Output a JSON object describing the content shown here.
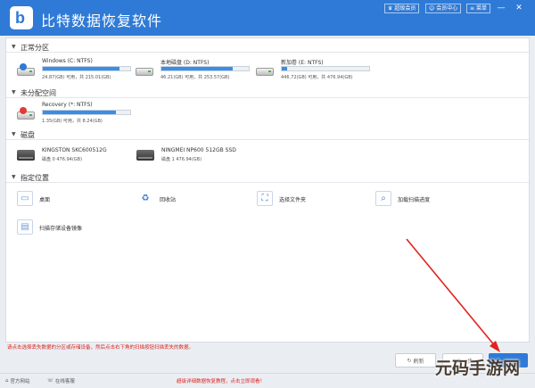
{
  "app": {
    "title": "比特数据恢复软件"
  },
  "titlebar": {
    "buttons": [
      {
        "label": "超级会员",
        "icon": "crown-icon"
      },
      {
        "label": "会员中心",
        "icon": "user-icon"
      },
      {
        "label": "菜单",
        "icon": "menu-icon"
      }
    ],
    "window_controls": {
      "minimize": "—",
      "close": "✕"
    }
  },
  "sections": {
    "partitions": "正常分区",
    "unallocated": "未分配空间",
    "disks": "磁盘",
    "locations": "指定位置"
  },
  "partitions": [
    {
      "name": "Windows (C: NTFS)",
      "size": "24.87(GB) 可用，共 215.01(GB)",
      "used_fraction": 0.88,
      "icon": "windows-drive-icon"
    },
    {
      "name": "本地磁盘 (D: NTFS)",
      "size": "46.21(GB) 可用，共 253.57(GB)",
      "used_fraction": 0.82,
      "icon": "local-drive-icon"
    },
    {
      "name": "新加卷 (E: NTFS)",
      "size": "446.72(GB) 可用，共 476.94(GB)",
      "used_fraction": 0.06,
      "icon": "volume-drive-icon"
    }
  ],
  "unallocated": [
    {
      "name": "Recovery (*: NTFS)",
      "size": "1.35(GB) 可用，共 8.24(GB)",
      "used_fraction": 0.84,
      "icon": "recovery-drive-icon"
    }
  ],
  "disks": [
    {
      "name": "KINGSTON SKC600512G",
      "info": "磁盘 0    476.94(GB)"
    },
    {
      "name": "NINGMEI NP600 512GB SSD",
      "info": "磁盘 1    476.94(GB)"
    }
  ],
  "locations": [
    {
      "label": "桌面",
      "icon": "desktop-icon"
    },
    {
      "label": "回收站",
      "icon": "recycle-bin-icon"
    },
    {
      "label": "选择文件夹",
      "icon": "folder-icon"
    },
    {
      "label": "加载扫描进度",
      "icon": "load-scan-icon"
    },
    {
      "label": "扫描存储设备镜像",
      "icon": "disk-image-icon"
    }
  ],
  "hint": "请点击选择丢失数据的分区或存储设备，然后点击右下角的扫描按钮扫描丢失的数据。",
  "buttons": {
    "refresh": "刷新",
    "back": "上一步"
  },
  "footer": {
    "website": "官方网站",
    "support": "在线客服",
    "tutorial": "超级详细数据恢复教程，点击立即观看！"
  },
  "watermark": "元码手游网",
  "colors": {
    "titlebar": "#2f7ad6",
    "hint": "#e0231e",
    "bar": "#3a8ee6"
  }
}
